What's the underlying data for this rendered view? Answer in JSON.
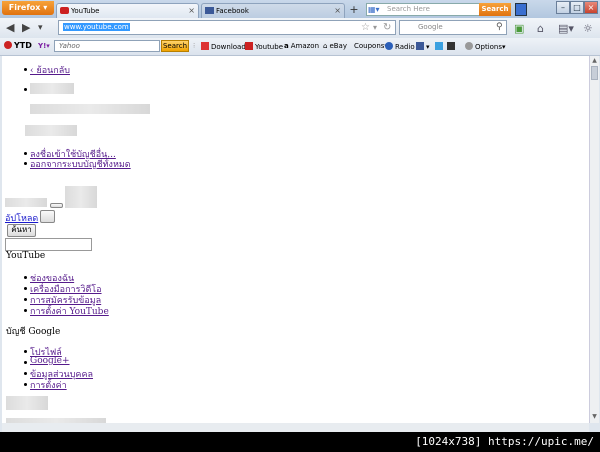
{
  "browser": {
    "app_button": "Firefox",
    "tabs": [
      {
        "label": "YouTube"
      },
      {
        "label": "Facebook"
      }
    ],
    "new_tab": "+",
    "search_here_placeholder": "Search Here",
    "search_button": "Search",
    "url": "www.youtube.com",
    "google_placeholder": "Google"
  },
  "toolbar": {
    "logo": "YTD",
    "yahoo_placeholder": "Yahoo",
    "search_label": "Search",
    "items": [
      "Download",
      "Youtube",
      "Amazon",
      "eBay",
      "Coupons",
      "Radio",
      "Options"
    ]
  },
  "page": {
    "back_link": "‹ ย้อนกลับ",
    "account_links": [
      "ลงชื่อเข้าใช้บัญชีอื่น...",
      "ออกจากระบบบัญชีทั้งหมด"
    ],
    "upload_link": "อัปโหลด",
    "search_button": "ค้นหา",
    "youtube_heading": "YouTube",
    "youtube_links": [
      "ช่องของฉัน",
      "เครื่องมือการวิดีโอ",
      "การสมัครรับข้อมูล",
      "การตั้งค่า YouTube"
    ],
    "google_heading": "บัญชี Google",
    "google_links": [
      "โปรไฟล์",
      "Google+",
      "ข้อมูลส่วนบุคคล",
      "การตั้งค่า"
    ]
  },
  "footer": {
    "caption": "[1024x738] https://upic.me/"
  },
  "colors": {
    "link_visited": "#551a8b",
    "firefox_orange": "#e0720f",
    "url_highlight": "#3399ff"
  }
}
